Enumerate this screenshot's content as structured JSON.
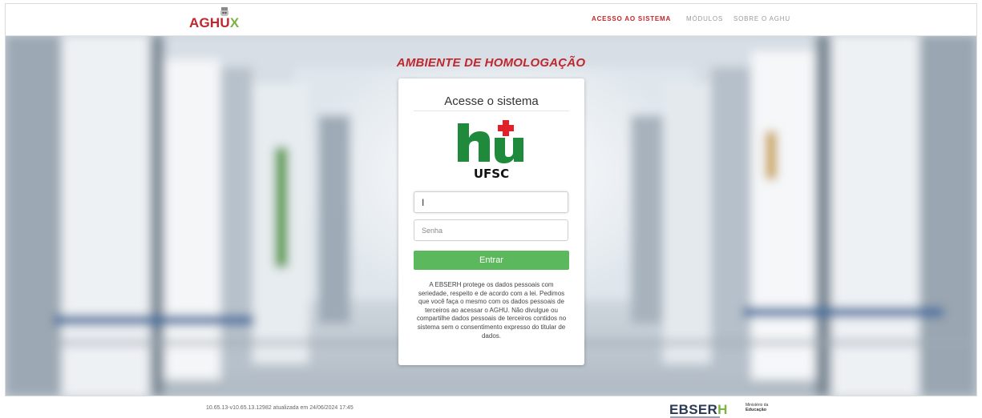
{
  "header": {
    "logo_text_a": "AGHU",
    "logo_text_b": "X",
    "nav": [
      {
        "label": "ACESSO AO SISTEMA"
      },
      {
        "label": "MÓDULOS"
      },
      {
        "label": "SOBRE O AGHU"
      }
    ]
  },
  "env_title": "AMBIENTE DE HOMOLOGAÇÃO",
  "login": {
    "title": "Acesse o sistema",
    "hospital_logo_text": "UFSC",
    "username_value": "I",
    "password_placeholder": "Senha",
    "submit_label": "Entrar",
    "privacy_text": "A EBSERH protege os dados pessoais com seriedade, respeito e de acordo com a lei. Pedimos que você faça o mesmo com os dados pessoais de terceiros ao acessar o AGHU. Não divulgue ou compartilhe dados pessoais de terceiros contidos no sistema sem o consentimento expresso do titular de dados."
  },
  "footer": {
    "version": "10.65.13-v10.65.13.12982 atualizada em 24/06/2024 17:45",
    "ebserh_a": "EBSER",
    "ebserh_b": "H",
    "mec_line1": "Ministério da",
    "mec_line2": "Educação"
  },
  "colors": {
    "brand_red": "#c0272d",
    "brand_green": "#7cb342",
    "button_green": "#5cb85c",
    "hu_green": "#1f8a3b"
  }
}
